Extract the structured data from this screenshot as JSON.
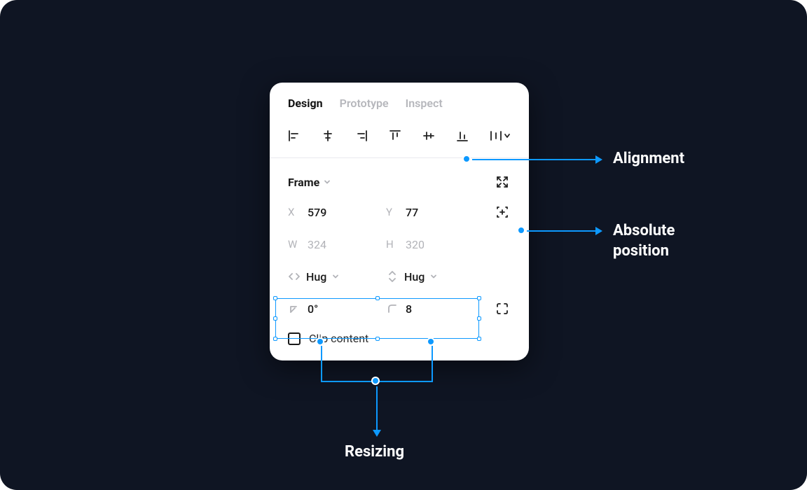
{
  "tabs": {
    "design": "Design",
    "prototype": "Prototype",
    "inspect": "Inspect"
  },
  "frame": {
    "title": "Frame",
    "x_label": "X",
    "x_value": "579",
    "y_label": "Y",
    "y_value": "77",
    "w_label": "W",
    "w_value": "324",
    "h_label": "H",
    "h_value": "320",
    "resize_h": "Hug",
    "resize_v": "Hug",
    "rotation": "0°",
    "radius": "8",
    "clip_label": "Clip content"
  },
  "annotations": {
    "alignment": "Alignment",
    "absolute": "Absolute position",
    "resizing": "Resizing"
  }
}
